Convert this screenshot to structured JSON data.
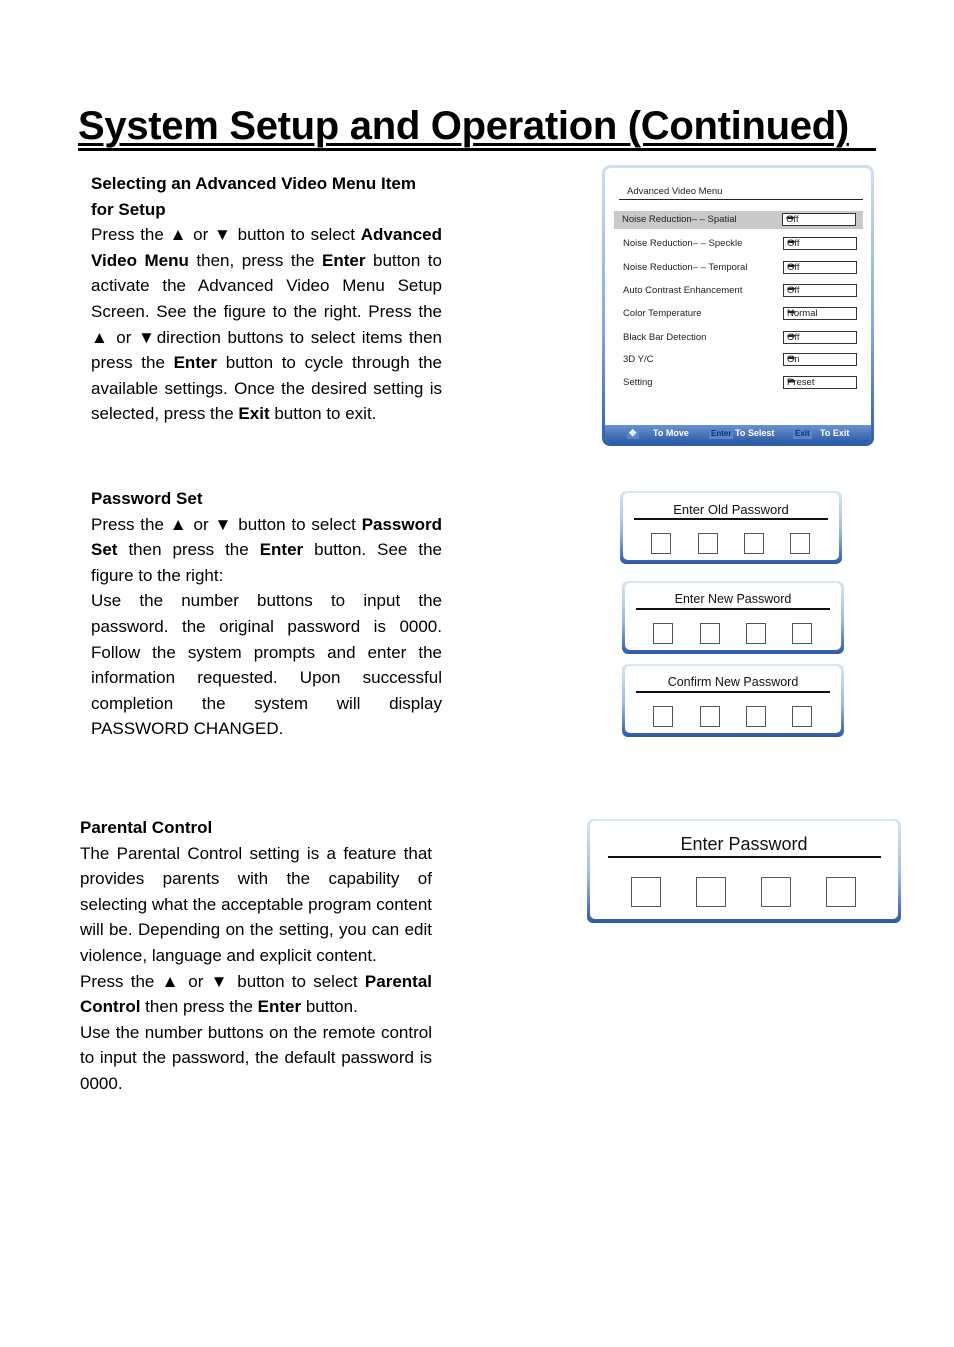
{
  "page": {
    "title": "System Setup and Operation (Continued)"
  },
  "sections": {
    "advanced_video": {
      "heading_line1": "Selecting an Advanced Video Menu Item",
      "heading_line2": "for Setup",
      "p1_a": "Press the ",
      "up": "▲",
      "or": " or ",
      "down": "▼",
      "p1_b": " button to select",
      "b_menu": "Advanced Video Menu",
      "p1_c": " then, press the",
      "b_enter": "Enter",
      "p1_d": " button to activate the Advanced Video Menu Setup Screen. See the figure to the right. Press the ▲ or ▼direction buttons to select items then press the ",
      "b_enter2": "Enter",
      "p1_e": " button to cycle through the available settings. Once the desired setting is selected, press the ",
      "b_exit": "Exit",
      "p1_f": " button to exit."
    },
    "password_set": {
      "heading": "Password Set",
      "p1_a": "Press the ▲ or ▼ button to select ",
      "b_pwset": "Password Set",
      "p1_b": " then press the ",
      "b_enter": "Enter",
      "p1_c": " button. See the figure to the right:",
      "p2": "Use the number buttons to input the password. the original password is 0000. Follow the system prompts and enter the information requested. Upon successful completion the system will display PASSWORD CHANGED."
    },
    "parental_control": {
      "heading": "Parental Control",
      "p1": "The Parental Control setting is a feature that provides parents with the capability of selecting what the acceptable program content will be. Depending on the setting, you can edit violence, language and explicit content.",
      "p2_a": "Press the ▲ or ▼ button to select ",
      "b_pc": "Parental Control",
      "p2_b": " then press the ",
      "b_enter": "Enter",
      "p2_c": " button.",
      "p3": "Use the number buttons on the remote control to input the password, the default password is 0000."
    }
  },
  "advanced_video_menu": {
    "title": "Advanced Video Menu",
    "items": [
      {
        "label": "Noise Reduction– – Spatial",
        "value": "Off",
        "selected": true
      },
      {
        "label": "Noise Reduction– – Speckle",
        "value": "Off",
        "selected": false
      },
      {
        "label": "Noise Reduction– – Temporal",
        "value": "Off",
        "selected": false
      },
      {
        "label": "Auto Contrast Enhancement",
        "value": "Off",
        "selected": false
      },
      {
        "label": "Color Temperature",
        "value": "Normal",
        "selected": false
      },
      {
        "label": "Black Bar Detection",
        "value": "Off",
        "selected": false
      },
      {
        "label": "3D Y/C",
        "value": "On",
        "selected": false
      },
      {
        "label": "Setting",
        "value": "Preset",
        "selected": false
      }
    ],
    "arrow_icon": "➡",
    "footer": {
      "move_key": "✥",
      "move_label": "To Move",
      "enter_key": "Enter",
      "enter_label": "To Selest",
      "exit_key": "Exit",
      "exit_label": "To Exit"
    }
  },
  "password_dialogs": {
    "old": "Enter Old Password",
    "new": "Enter New Password",
    "confirm": "Confirm New Password",
    "parental": "Enter Password"
  }
}
